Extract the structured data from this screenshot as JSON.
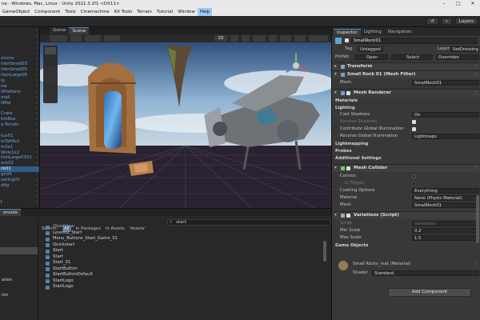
{
  "titlebar": {
    "title": "ne - Windows, Mac, Linux - Unity 2021.3.2f1 <DX11>"
  },
  "menu": [
    "GameObject",
    "Component",
    "Tools",
    "Cinemachine",
    "Kit Tools",
    "Terrain",
    "Tutorial",
    "Window",
    "Help"
  ],
  "toolbar": {
    "layers_label": "Layers"
  },
  "view_tabs": {
    "game": "Game",
    "scene": "Scene"
  },
  "scene_toolbar": {
    "two_d": "2D"
  },
  "hierarchy": {
    "rows": [
      {
        "label": "",
        "style": "blue"
      },
      {
        "label": "",
        "style": "blue"
      },
      {
        "label": "",
        "style": "blue"
      },
      {
        "label": "",
        "style": "blue"
      },
      {
        "label": "",
        "style": "blue"
      },
      {
        "label": "elume",
        "style": "blue"
      },
      {
        "label": "itionSmall03",
        "style": "blue"
      },
      {
        "label": "itionSmall05",
        "style": "blue"
      },
      {
        "label": "itionLarge05",
        "style": "blue"
      },
      {
        "label": "ip",
        "style": "blue"
      },
      {
        "label": "ow",
        "style": "blue"
      },
      {
        "label": "ilPlatform",
        "style": "blue"
      },
      {
        "label": "mall",
        "style": "blue"
      },
      {
        "label": "llMid",
        "style": "blue"
      },
      {
        "label": "",
        "style": "blue"
      },
      {
        "label": "Crate",
        "style": "blue"
      },
      {
        "label": "ttleBox",
        "style": "blue"
      },
      {
        "label": "e-Terrain",
        "style": "blue"
      },
      {
        "label": "",
        "style": "blue"
      },
      {
        "label": "tue01",
        "style": "blue"
      },
      {
        "label": "mTall4x1",
        "style": "blue"
      },
      {
        "label": "m3x1",
        "style": "blue"
      },
      {
        "label": "Wide1x2",
        "style": "blue"
      },
      {
        "label": "tionLarge03V2",
        "style": "blue"
      },
      {
        "label": "ock02",
        "style": "blue"
      },
      {
        "label": "ck01",
        "style": "sel"
      },
      {
        "label": "ge04",
        "style": "blue"
      },
      {
        "label": "oating03",
        "style": "blue"
      },
      {
        "label": "dfig",
        "style": "blue"
      },
      {
        "label": "",
        "style": "blue"
      },
      {
        "label": "",
        "style": "plain"
      },
      {
        "label": "l",
        "style": "plain"
      }
    ]
  },
  "console": {
    "tab": "onsole",
    "search_value": "start",
    "filters": {
      "prefix": "Search:",
      "all": "All",
      "packages": "In Packages",
      "assets": "In Assets",
      "quoted": "'Assets'"
    },
    "left_rows": [
      {
        "label": "",
        "sel": false
      },
      {
        "label": "",
        "sel": false
      },
      {
        "label": "",
        "sel": false
      },
      {
        "label": "",
        "sel": false
      },
      {
        "label": "",
        "sel": true
      },
      {
        "label": "",
        "sel": false
      },
      {
        "label": "",
        "sel": false
      },
      {
        "label": "",
        "sel": false
      },
      {
        "label": "ation",
        "sel": false
      },
      {
        "label": "",
        "sel": false
      },
      {
        "label": "ion",
        "sel": false
      },
      {
        "label": "",
        "sel": false
      }
    ],
    "results": [
      "Level02_Start",
      "Menu_Buttons_Start_Game_01",
      "Quickstart",
      "Start",
      "Start",
      "Start_01",
      "StartButton",
      "StartButtonDefault",
      "StartLogo",
      "StartLogo"
    ]
  },
  "inspector": {
    "tabs": {
      "inspector": "Inspector",
      "lighting": "Lighting",
      "navigation": "Navigation"
    },
    "object_name": "SmallRock01",
    "tag_label": "Tag",
    "tag_value": "Untagged",
    "layer_label": "Layer",
    "layer_value": "SetDressing",
    "prefab": {
      "label": "Prefab",
      "open": "Open",
      "select": "Select",
      "overrides": "Overrides"
    },
    "transform": "Transform",
    "mesh_filter": "Small Rock 01 (Mesh Filter)",
    "mesh_label": "Mesh",
    "mesh_value": "SmallRock01",
    "mesh_renderer": "Mesh Renderer",
    "materials": "Materials",
    "lighting": "Lighting",
    "cast_shadows": {
      "label": "Cast Shadows",
      "value": "On"
    },
    "receive_shadows": {
      "label": "Receive Shadows"
    },
    "contribute_gi": {
      "label": "Contribute Global Illumination"
    },
    "receive_gi": {
      "label": "Receive Global Illumination",
      "value": "Lightmaps"
    },
    "lightmapping": "Lightmapping",
    "probes": "Probes",
    "additional": "Additional Settings",
    "mesh_collider": "Mesh Collider",
    "convex": {
      "label": "Convex"
    },
    "is_trigger": {
      "label": "Is Trigger"
    },
    "cooking": {
      "label": "Cooking Options",
      "value": "Everything"
    },
    "material": {
      "label": "Material",
      "value": "None (Physic Material)"
    },
    "collider_mesh": {
      "label": "Mesh",
      "value": "SmallRock01"
    },
    "variations": "Variations (Script)",
    "script": {
      "label": "Script",
      "value": "Variations"
    },
    "min_scale": {
      "label": "Min Scale",
      "value": "0.2"
    },
    "max_scale": {
      "label": "Max Scale",
      "value": "1.5"
    },
    "game_objects": "Game Objects",
    "material_asset": "Small Rocks_mat (Material)",
    "shader": {
      "label": "Shader",
      "value": "Standard"
    },
    "add_component": "Add Component"
  },
  "colors": {
    "accent": "#4a90d9",
    "selection": "#2c5d87",
    "panel": "#383838",
    "header": "#3e3e3e"
  }
}
